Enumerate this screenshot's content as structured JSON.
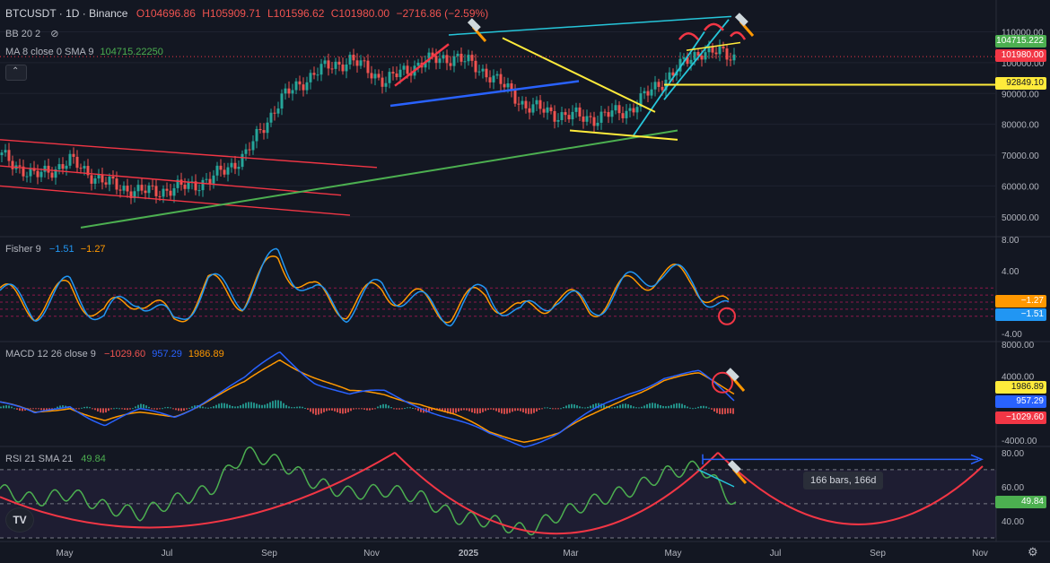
{
  "header": {
    "symbol": "BTCUSDT · 1D · Binance",
    "open": "O104696.86",
    "high": "H105909.71",
    "low": "L101596.62",
    "close": "C101980.00",
    "change": "−2716.86 (−2.59%)",
    "bb": "BB 20 2",
    "ma_label": "MA 8 close 0 SMA 9",
    "ma_value": "104715.22250"
  },
  "indicators": {
    "fisher_label": "Fisher 9",
    "fisher_v1": "−1.51",
    "fisher_v2": "−1.27",
    "macd_label": "MACD 12 26 close 9",
    "macd_v1": "−1029.60",
    "macd_v2": "957.29",
    "macd_v3": "1986.89",
    "rsi_label": "RSI 21 SMA 21",
    "rsi_v1": "49.84"
  },
  "price_tags": {
    "ma": "104715.222",
    "close": "101980.00",
    "level": "92849.10",
    "fisher_a": "−1.27",
    "fisher_b": "−1.51",
    "macd_a": "1986.89",
    "macd_b": "957.29",
    "macd_c": "−1029.60",
    "rsi": "49.84"
  },
  "measure_label": "166 bars, 166d",
  "colors": {
    "bg": "#131722",
    "up": "#26a69a",
    "down": "#ef5350",
    "yellow": "#ffeb3b",
    "green_line": "#4caf50",
    "cyan": "#26c6da",
    "blue": "#2962ff",
    "red_line": "#f23645"
  },
  "chart_data": [
    {
      "type": "line",
      "title": "BTCUSDT · 1D · Binance",
      "x": [
        "2024-04-01",
        "2024-05-01",
        "2024-06-01",
        "2024-07-01",
        "2024-08-01",
        "2024-09-01",
        "2024-10-01",
        "2024-11-01",
        "2024-11-15",
        "2024-12-01",
        "2024-12-15",
        "2025-01-01",
        "2025-01-15",
        "2025-02-01",
        "2025-02-15",
        "2025-03-01",
        "2025-03-15",
        "2025-04-01",
        "2025-04-15",
        "2025-05-01",
        "2025-05-15",
        "2025-06-01"
      ],
      "series": [
        {
          "values": [
            70000,
            63000,
            68000,
            61000,
            58000,
            59000,
            62000,
            70000,
            88000,
            97000,
            101000,
            94000,
            100000,
            102000,
            96000,
            86000,
            83000,
            82000,
            85000,
            95000,
            104000,
            102000
          ]
        }
      ],
      "ylim": [
        45000,
        118000
      ],
      "y_ticks": [
        "110000.00",
        "100000.00",
        "90000.00",
        "80000.00",
        "70000.00",
        "60000.00",
        "50000.00"
      ],
      "x_ticks": [
        "May",
        "Jul",
        "Sep",
        "Nov",
        "2025",
        "Mar",
        "May",
        "Jul",
        "Sep",
        "Nov"
      ]
    },
    {
      "type": "line",
      "title": "Fisher 9",
      "series": [
        {
          "name": "−1.51",
          "values": [
            1.5,
            -1.0,
            2.0,
            -2.0,
            1.0,
            -3.0,
            2.5,
            0.5,
            6.0,
            1.0,
            -1.0,
            2.0,
            0.0,
            -1.5,
            1.5,
            -2.0,
            1.0,
            -1.0,
            2.0,
            4.0,
            2.5,
            -1.51
          ]
        },
        {
          "name": "−1.27",
          "values": [
            1.2,
            -0.8,
            1.7,
            -1.7,
            0.9,
            -2.6,
            2.2,
            0.4,
            5.5,
            1.2,
            -0.7,
            1.7,
            0.2,
            -1.2,
            1.2,
            -1.7,
            0.8,
            -0.8,
            1.7,
            3.7,
            2.7,
            -1.27
          ]
        }
      ],
      "ylim": [
        -4,
        8
      ],
      "y_ticks": [
        "8.00",
        "4.00",
        "-4.00"
      ]
    },
    {
      "type": "bar",
      "title": "MACD 12 26 close 9",
      "series": [
        {
          "name": "−1029.60",
          "values": [
            200,
            -300,
            250,
            -400,
            300,
            -200,
            350,
            500,
            800,
            -600,
            -400,
            300,
            -300,
            -500,
            -400,
            -600,
            200,
            400,
            300,
            500,
            200,
            -1029.6
          ]
        },
        {
          "name": "957.29",
          "values": [
            800,
            -1000,
            500,
            -2000,
            -500,
            -1000,
            1500,
            3500,
            7000,
            3500,
            1500,
            2000,
            500,
            -1500,
            -3500,
            -4500,
            -3000,
            -500,
            2000,
            4000,
            4300,
            957.29
          ]
        },
        {
          "name": "1986.89",
          "values": [
            600,
            -700,
            300,
            -1600,
            -800,
            -800,
            1100,
            3000,
            6200,
            4000,
            1900,
            1700,
            800,
            -1000,
            -3100,
            -3900,
            -3200,
            -900,
            1700,
            3500,
            4100,
            1986.89
          ]
        }
      ],
      "ylim": [
        -4000,
        8000
      ],
      "y_ticks": [
        "8000.00",
        "4000.00",
        "-4000.00"
      ]
    },
    {
      "type": "line",
      "title": "RSI 21 SMA 21",
      "series": [
        {
          "name": "49.84",
          "values": [
            58,
            52,
            56,
            48,
            44,
            52,
            58,
            80,
            74,
            62,
            56,
            58,
            54,
            42,
            40,
            34,
            44,
            52,
            58,
            68,
            72,
            49.84
          ]
        }
      ],
      "ylim": [
        30,
        82
      ],
      "y_ticks": [
        "80.00",
        "60.00",
        "40.00"
      ]
    }
  ]
}
